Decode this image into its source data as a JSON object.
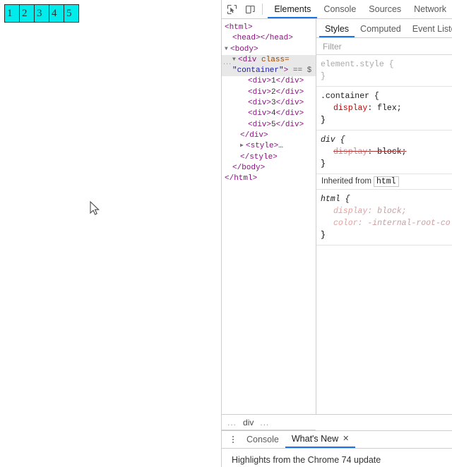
{
  "page": {
    "boxes": [
      {
        "label": "1"
      },
      {
        "label": "2"
      },
      {
        "label": "3"
      },
      {
        "label": "4"
      },
      {
        "label": "5"
      }
    ],
    "box_color": "#00ebeb",
    "box_border_color": "#2a2a2a",
    "cursor_icon": "mouse-pointer-icon"
  },
  "devtools": {
    "toolbar": {
      "inspect_icon": "inspect-element-icon",
      "device_icon": "device-toolbar-icon",
      "tabs": [
        {
          "label": "Elements",
          "active": true
        },
        {
          "label": "Console",
          "active": false
        },
        {
          "label": "Sources",
          "active": false
        },
        {
          "label": "Network",
          "active": false
        }
      ]
    },
    "dom_tree": {
      "selected_badge": "...",
      "rows": [
        {
          "indent": 0,
          "html": "<span class=\"tag\">&lt;html&gt;</span>"
        },
        {
          "indent": 1,
          "html": "<span class=\"tag\">&lt;head&gt;&lt;/head&gt;</span>"
        },
        {
          "indent": 0,
          "html": "<span class=\"tri\">&#9660;</span><span class=\"tag\">&lt;body&gt;</span>"
        },
        {
          "indent": 1,
          "html": "<span class=\"tri\">&#9660;</span><span class=\"tag\">&lt;div </span><span class=\"attr-n\">class=</span>",
          "selected": true
        },
        {
          "indent": 1,
          "html": "<span class=\"attr-v\">\"container\"</span><span class=\"tag\">&gt;</span> <span class=\"eq0\">== $</span>",
          "selected": true,
          "nopad": true
        },
        {
          "indent": 3,
          "html": "<span class=\"tag\">&lt;div&gt;</span><span class=\"txt\">1</span><span class=\"tag\">&lt;/div&gt;</span>"
        },
        {
          "indent": 3,
          "html": "<span class=\"tag\">&lt;div&gt;</span><span class=\"txt\">2</span><span class=\"tag\">&lt;/div&gt;</span>"
        },
        {
          "indent": 3,
          "html": "<span class=\"tag\">&lt;div&gt;</span><span class=\"txt\">3</span><span class=\"tag\">&lt;/div&gt;</span>"
        },
        {
          "indent": 3,
          "html": "<span class=\"tag\">&lt;div&gt;</span><span class=\"txt\">4</span><span class=\"tag\">&lt;/div&gt;</span>"
        },
        {
          "indent": 3,
          "html": "<span class=\"tag\">&lt;div&gt;</span><span class=\"txt\">5</span><span class=\"tag\">&lt;/div&gt;</span>"
        },
        {
          "indent": 2,
          "html": "<span class=\"tag\">&lt;/div&gt;</span>"
        },
        {
          "indent": 2,
          "html": "<span class=\"tri\">&#9654;</span><span class=\"tag\">&lt;style&gt;</span><span class=\"txt\">&#8230;</span>"
        },
        {
          "indent": 2,
          "html": "<span class=\"tag\">&lt;/style&gt;</span>"
        },
        {
          "indent": 1,
          "html": "<span class=\"tag\">&lt;/body&gt;</span>"
        },
        {
          "indent": 0,
          "html": "<span class=\"tag\">&lt;/html&gt;</span>"
        }
      ]
    },
    "styles": {
      "tabs": [
        {
          "label": "Styles",
          "active": true
        },
        {
          "label": "Computed",
          "active": false
        },
        {
          "label": "Event Listen",
          "active": false
        }
      ],
      "filter_placeholder": "Filter",
      "rules": [
        {
          "selector": "element.style {",
          "close": "}",
          "dim": true,
          "declarations": []
        },
        {
          "selector": ".container {",
          "close": "}",
          "dim": false,
          "declarations": [
            {
              "prop": "display",
              "value": "flex;",
              "struck": false
            }
          ]
        },
        {
          "selector": "div {",
          "close": "}",
          "dim": false,
          "ua": true,
          "declarations": [
            {
              "prop": "display",
              "value": "block;",
              "struck": true
            }
          ]
        }
      ],
      "inherited_label": "Inherited from",
      "inherited_source": "html",
      "inherited_rule": {
        "selector": "html {",
        "close": "}",
        "declarations": [
          {
            "prop": "display",
            "value": "block;"
          },
          {
            "prop": "color",
            "value": "-internal-root-color"
          }
        ]
      }
    },
    "breadcrumb": {
      "left_dots": "...",
      "current": "div",
      "right_dots": "..."
    },
    "drawer": {
      "menu_icon": "kebab-menu-icon",
      "tabs": [
        {
          "label": "Console",
          "active": false,
          "closable": false
        },
        {
          "label": "What's New",
          "active": true,
          "closable": true,
          "close_icon": "close-icon",
          "close_glyph": "✕"
        }
      ],
      "body_text": "Highlights from the Chrome 74 update"
    }
  }
}
